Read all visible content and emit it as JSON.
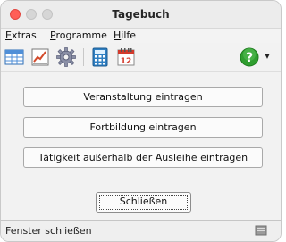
{
  "window": {
    "title": "Tagebuch"
  },
  "menubar": {
    "items": [
      {
        "label": "Extras",
        "underline": "E",
        "rest": "xtras"
      },
      {
        "label": "Programme",
        "underline": "P",
        "rest": "rogramme"
      },
      {
        "label": "Hilfe",
        "underline": "H",
        "rest": "ilfe"
      }
    ]
  },
  "toolbar": {
    "icons": [
      "table-icon",
      "chart-icon",
      "gear-icon",
      "calculator-icon",
      "calendar-icon",
      "help-icon",
      "dropdown-arrow-icon"
    ],
    "calendar_day": "12",
    "help_glyph": "?",
    "dropdown_glyph": "▾"
  },
  "actions": {
    "veranstaltung": "Veranstaltung eintragen",
    "fortbildung": "Fortbildung eintragen",
    "taetigkeit": "Tätigkeit außerhalb der Ausleihe eintragen"
  },
  "close_button": {
    "label": "Schließen",
    "mnemonic": "c"
  },
  "statusbar": {
    "text": "Fenster schließen"
  },
  "colors": {
    "close_traffic": "#ff5f57",
    "help_green": "#2f9e2f",
    "calendar_red": "#d33a2c"
  }
}
